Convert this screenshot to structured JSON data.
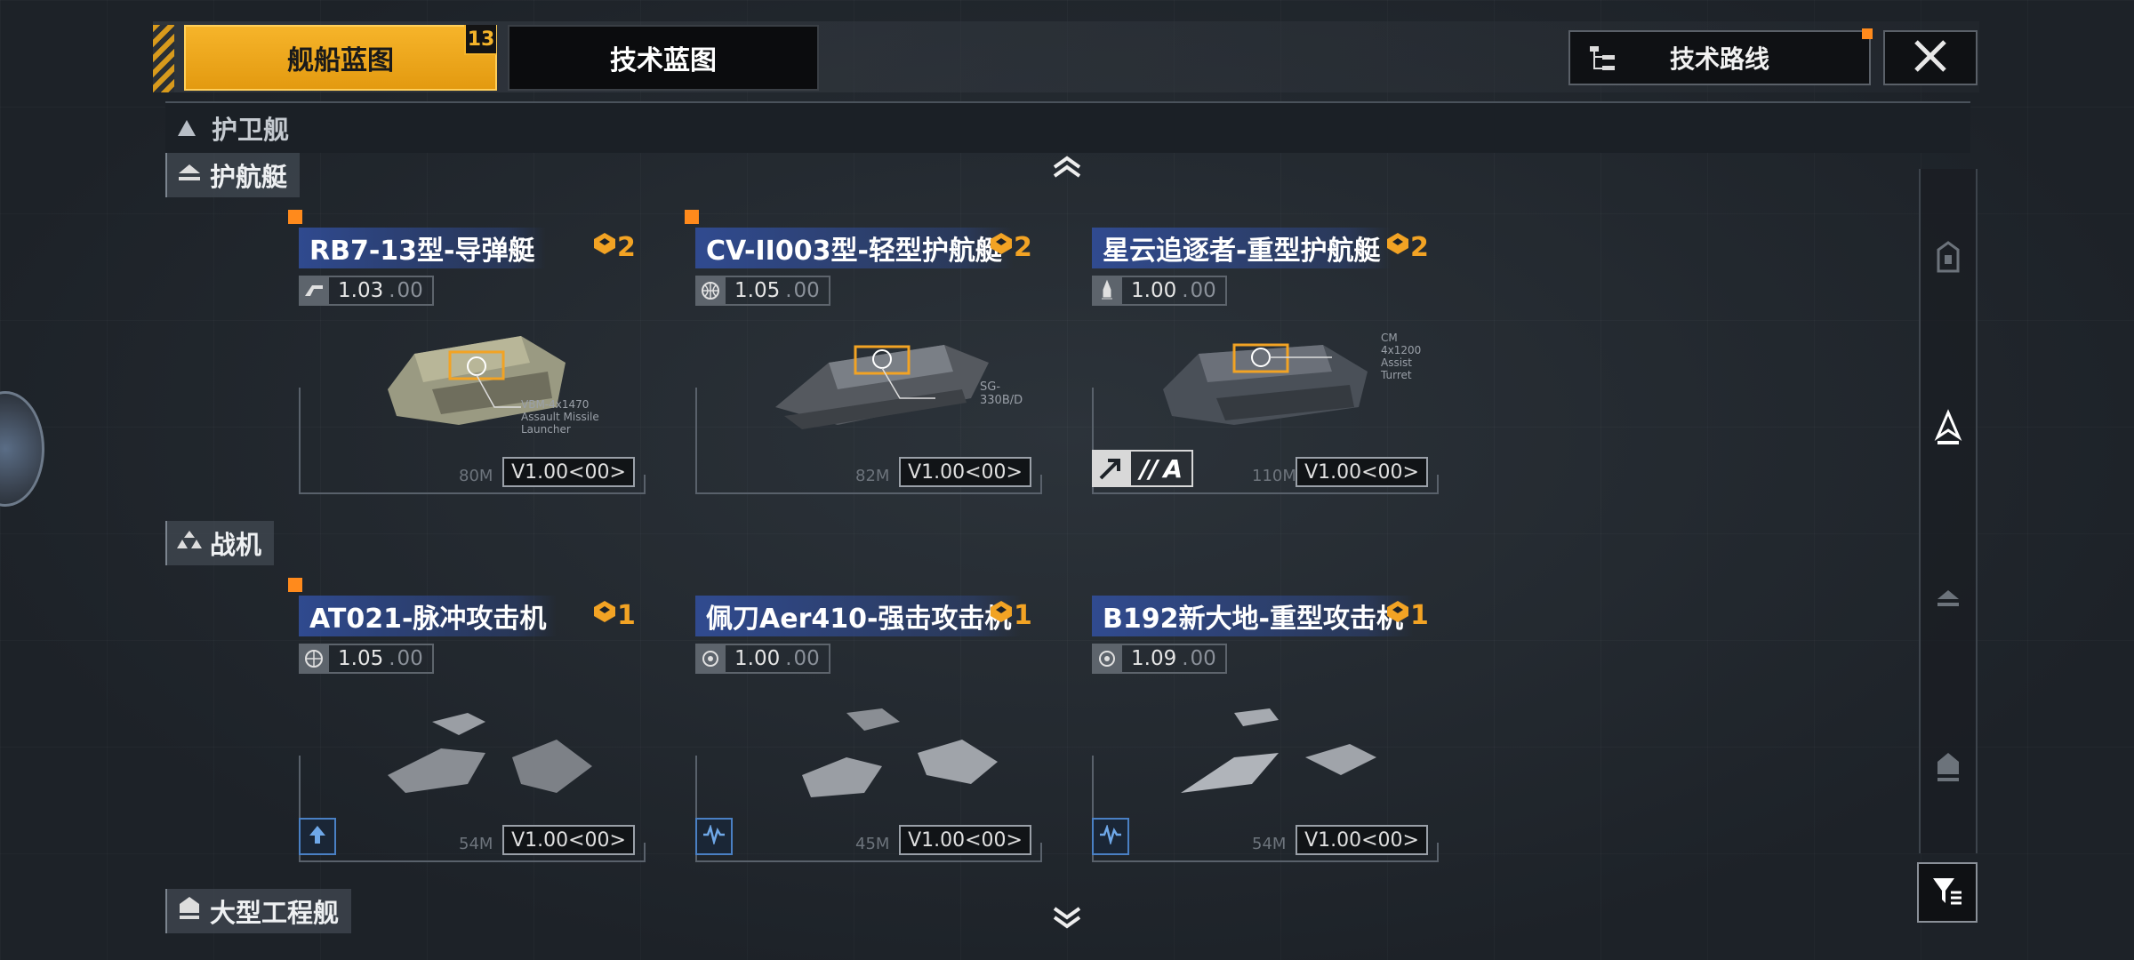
{
  "tabs": {
    "active_label": "舰船蓝图",
    "active_badge": "13",
    "inactive_label": "技术蓝图"
  },
  "header": {
    "route_label": "技术路线",
    "close_icon": "close-icon"
  },
  "category": {
    "title": "护卫舰"
  },
  "sections": [
    {
      "label": "护航艇",
      "icon": "escort-icon"
    },
    {
      "label": "战机",
      "icon": "fighter-icon"
    },
    {
      "label": "大型工程舰",
      "icon": "engineering-icon"
    }
  ],
  "cards": [
    {
      "name": "RB7-13型-导弹艇",
      "rank": "2",
      "version": "1.03",
      "version_dim": "00",
      "size": "80M",
      "badge": "V1.00<00>",
      "new": true,
      "role": "",
      "grade": "",
      "ver_icon": "manufacturer-icon"
    },
    {
      "name": "CV-II003型-轻型护航艇",
      "rank": "2",
      "version": "1.05",
      "version_dim": "00",
      "size": "82M",
      "badge": "V1.00<00>",
      "new": true,
      "role": "",
      "grade": "",
      "ver_icon": "globe-icon"
    },
    {
      "name": "星云追逐者-重型护航艇",
      "rank": "2",
      "version": "1.00",
      "version_dim": "00",
      "size": "110M",
      "badge": "V1.00<00>",
      "new": false,
      "role": "",
      "grade": "A",
      "ver_icon": "rocket-icon"
    },
    {
      "name": "AT021-脉冲攻击机",
      "rank": "1",
      "version": "1.05",
      "version_dim": "00",
      "size": "54M",
      "badge": "V1.00<00>",
      "new": true,
      "role": "attack-up-icon",
      "grade": "",
      "ver_icon": "globe-icon"
    },
    {
      "name": "佩刀Aer410-强击攻击机",
      "rank": "1",
      "version": "1.00",
      "version_dim": "00",
      "size": "45M",
      "badge": "V1.00<00>",
      "new": false,
      "role": "pulse-icon",
      "grade": "",
      "ver_icon": "engine-icon"
    },
    {
      "name": "B192新大地-重型攻击机",
      "rank": "1",
      "version": "1.09",
      "version_dim": "00",
      "size": "54M",
      "badge": "V1.00<00>",
      "new": false,
      "role": "pulse-icon",
      "grade": "",
      "ver_icon": "engine-icon"
    }
  ],
  "ship_callouts": [
    "VBM-4x1470",
    "Assault Missile Launcher",
    "SG-330B/D",
    "CM 4x1200",
    "Assist Turret"
  ],
  "colors": {
    "accent": "#f2a324",
    "name_bar": "#3250a0",
    "new_marker": "#ff8a1c"
  }
}
